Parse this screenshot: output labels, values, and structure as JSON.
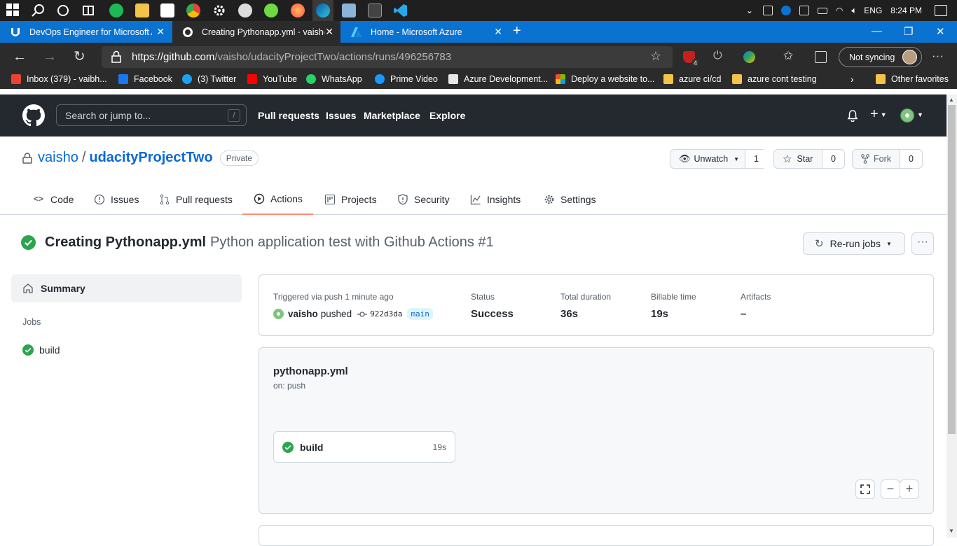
{
  "taskbar": {
    "language": "ENG",
    "time": "8:24 PM"
  },
  "browser": {
    "tabs": [
      {
        "title": "DevOps Engineer for Microsoft A"
      },
      {
        "title": "Creating Pythonapp.yml · vaisho/"
      },
      {
        "title": "Home - Microsoft Azure"
      }
    ],
    "url_host": "https://github.com",
    "url_path": "/vaisho/udacityProjectTwo/actions/runs/496256783",
    "extension_badge": "4",
    "sync_label": "Not syncing",
    "favorites": [
      {
        "label": "Inbox (379) - vaibh..."
      },
      {
        "label": "Facebook"
      },
      {
        "label": "(3) Twitter"
      },
      {
        "label": "YouTube"
      },
      {
        "label": "WhatsApp"
      },
      {
        "label": "Prime Video"
      },
      {
        "label": "Azure Development..."
      },
      {
        "label": "Deploy a website to..."
      },
      {
        "label": "azure ci/cd"
      },
      {
        "label": "azure cont testing"
      }
    ],
    "other_favorites": "Other favorites"
  },
  "github": {
    "search_placeholder": "Search or jump to...",
    "search_key": "/",
    "nav": [
      "Pull requests",
      "Issues",
      "Marketplace",
      "Explore"
    ]
  },
  "repo": {
    "owner": "vaisho",
    "separator": "/",
    "name": "udacityProjectTwo",
    "visibility": "Private",
    "unwatch_label": "Unwatch",
    "watch_count": "1",
    "star_label": "Star",
    "star_count": "0",
    "fork_label": "Fork",
    "fork_count": "0",
    "tabs": [
      "Code",
      "Issues",
      "Pull requests",
      "Actions",
      "Projects",
      "Security",
      "Insights",
      "Settings"
    ],
    "active_tab": "Actions"
  },
  "run": {
    "commit_title": "Creating Pythonapp.yml",
    "workflow_title": "Python application test with Github Actions #1",
    "rerun_label": "Re-run jobs",
    "more_label": "···"
  },
  "sidebar": {
    "summary_label": "Summary",
    "jobs_heading": "Jobs",
    "jobs": [
      {
        "name": "build"
      }
    ]
  },
  "summary_card": {
    "triggered_label": "Triggered via push 1 minute ago",
    "user": "vaisho",
    "action": "pushed",
    "sha": "922d3da",
    "branch": "main",
    "status_label": "Status",
    "status_value": "Success",
    "duration_label": "Total duration",
    "duration_value": "36s",
    "billable_label": "Billable time",
    "billable_value": "19s",
    "artifacts_label": "Artifacts",
    "artifacts_value": "–"
  },
  "workflow_graph": {
    "file": "pythonapp.yml",
    "trigger": "on: push",
    "job_name": "build",
    "job_duration": "19s",
    "zoom_out": "−",
    "zoom_in": "+"
  },
  "colors": {
    "success": "#2da44e",
    "link": "#0969da",
    "header_bg": "#24292f",
    "active_tab_underline": "#fd8c73"
  }
}
